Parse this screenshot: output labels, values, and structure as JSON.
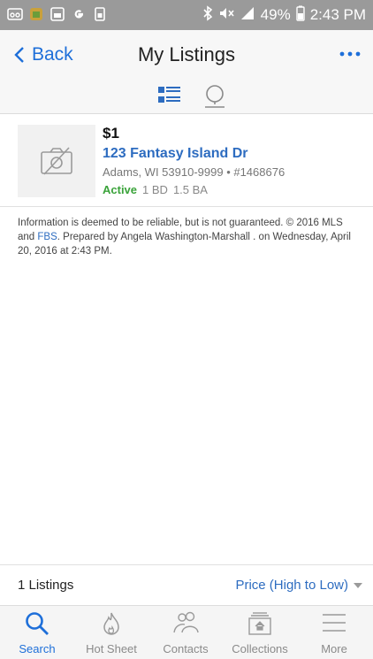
{
  "status_bar": {
    "battery": "49%",
    "time": "2:43 PM",
    "color": "#9a9a9a"
  },
  "header": {
    "back_label": "Back",
    "title": "My Listings",
    "accent": "#1e6fd9"
  },
  "view_toggle": {
    "selected": "list",
    "icons": [
      "list-view-icon",
      "map-pin-icon"
    ]
  },
  "listings": [
    {
      "price": "$1",
      "address": "123 Fantasy Island Dr",
      "city_line": "Adams, WI 53910-9999 • #1468676",
      "status": "Active",
      "beds": "1 BD",
      "baths": "1.5 BA",
      "photo": "no-photo-icon"
    }
  ],
  "disclaimer": {
    "part1": "Information is deemed to be reliable, but is not guaranteed. © 2016 MLS and ",
    "link": "FBS",
    "part2": ". Prepared by Angela Washington-Marshall . on Wednesday, April 20, 2016 at 2:43 PM."
  },
  "footer": {
    "count": "1 Listings",
    "sort": "Price (High to Low)"
  },
  "bottom_nav": [
    {
      "label": "Search",
      "icon": "search-icon",
      "active": true
    },
    {
      "label": "Hot Sheet",
      "icon": "flame-icon",
      "active": false
    },
    {
      "label": "Contacts",
      "icon": "contacts-icon",
      "active": false
    },
    {
      "label": "Collections",
      "icon": "collections-icon",
      "active": false
    },
    {
      "label": "More",
      "icon": "menu-icon",
      "active": false
    }
  ]
}
